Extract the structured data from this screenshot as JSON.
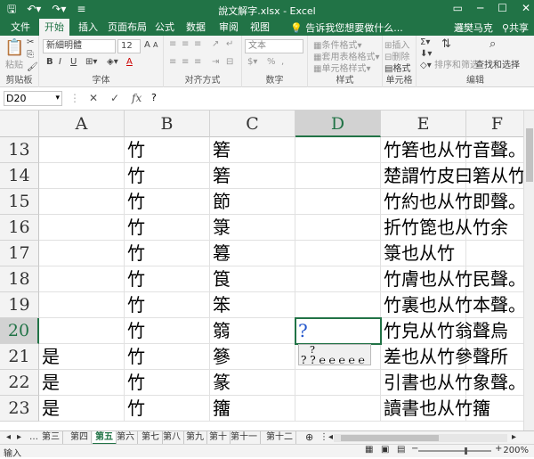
{
  "app": {
    "title": "說文解字.xlsx - Excel",
    "qat": {
      "save_icon": "save-icon",
      "undo_icon": "undo-icon",
      "redo_icon": "redo-icon"
    }
  },
  "tabs": {
    "items": [
      "文件",
      "开始",
      "插入",
      "页面布局",
      "公式",
      "数据",
      "审阅",
      "视图"
    ],
    "active": 1,
    "tellme": "告诉我您想要做什么...",
    "user": "邏樊马克",
    "share": "共享"
  },
  "ribbon": {
    "clipboard": {
      "label": "剪贴板",
      "paste": "粘贴"
    },
    "font": {
      "label": "字体",
      "name": "新細明體",
      "size": "12",
      "bold": "B",
      "italic": "I",
      "underline": "U",
      "grow": "A",
      "shrink": "A",
      "font_color": "A"
    },
    "alignment": {
      "label": "对齐方式"
    },
    "number": {
      "label": "数字",
      "format": "文本",
      "pct": "%",
      "comma": ","
    },
    "styles": {
      "label": "样式",
      "cond": "条件格式",
      "table": "套用表格格式",
      "cell": "单元格样式"
    },
    "cells": {
      "label": "单元格",
      "insert": "插入",
      "delete": "删除",
      "format": "格式"
    },
    "editing": {
      "label": "编辑",
      "sort": "排序和筛选",
      "find": "查找和选择"
    }
  },
  "formula": {
    "namebox": "D20",
    "cancel": "✕",
    "enter": "✓",
    "fx": "fx",
    "content": "?"
  },
  "columns": [
    "A",
    "B",
    "C",
    "D",
    "E",
    "F"
  ],
  "selected_col": "D",
  "rows": [
    {
      "n": "13",
      "A": "",
      "B": "竹",
      "C": "箬",
      "D": "",
      "E": "竹箬也从竹音聲。"
    },
    {
      "n": "14",
      "A": "",
      "B": "竹",
      "C": "箬",
      "D": "",
      "E": "楚謂竹皮曰箬从竹"
    },
    {
      "n": "15",
      "A": "",
      "B": "竹",
      "C": "節",
      "D": "",
      "E": "竹約也从竹即聲。"
    },
    {
      "n": "16",
      "A": "",
      "B": "竹",
      "C": "箓",
      "D": "",
      "E": "折竹箆也从竹余"
    },
    {
      "n": "17",
      "A": "",
      "B": "竹",
      "C": "篹",
      "D": "",
      "E": "箓也从竹𥳍"
    },
    {
      "n": "18",
      "A": "",
      "B": "竹",
      "C": "筤",
      "D": "",
      "E": "竹膚也从竹民聲。"
    },
    {
      "n": "19",
      "A": "",
      "B": "竹",
      "C": "笨",
      "D": "",
      "E": "竹裏也从竹本聲。"
    },
    {
      "n": "20",
      "A": "",
      "B": "竹",
      "C": "篛",
      "D": "?",
      "E": "竹皃从竹翁聲烏"
    },
    {
      "n": "21",
      "A": "是",
      "B": "竹",
      "C": "篸",
      "D": "",
      "E": "差也从竹參聲所"
    },
    {
      "n": "22",
      "A": "是",
      "B": "竹",
      "C": "篆",
      "D": "",
      "E": "引書也从竹象聲。"
    },
    {
      "n": "23",
      "A": "是",
      "B": "竹",
      "C": "籒",
      "D": "",
      "E": "讀書也从竹籒"
    }
  ],
  "selected_row": "20",
  "ime": {
    "line1": "?",
    "line2": "? ? ℮ ℮ ℮ ℮ ℮"
  },
  "sheets": [
    "第三",
    "第四",
    "第五",
    "第六",
    "第七",
    "第八",
    "第九",
    "第十",
    "第十一",
    "第十二"
  ],
  "active_sheet": "第五",
  "status": {
    "mode": "输入",
    "zoom": "200%",
    "zoom_level": 0.64
  }
}
